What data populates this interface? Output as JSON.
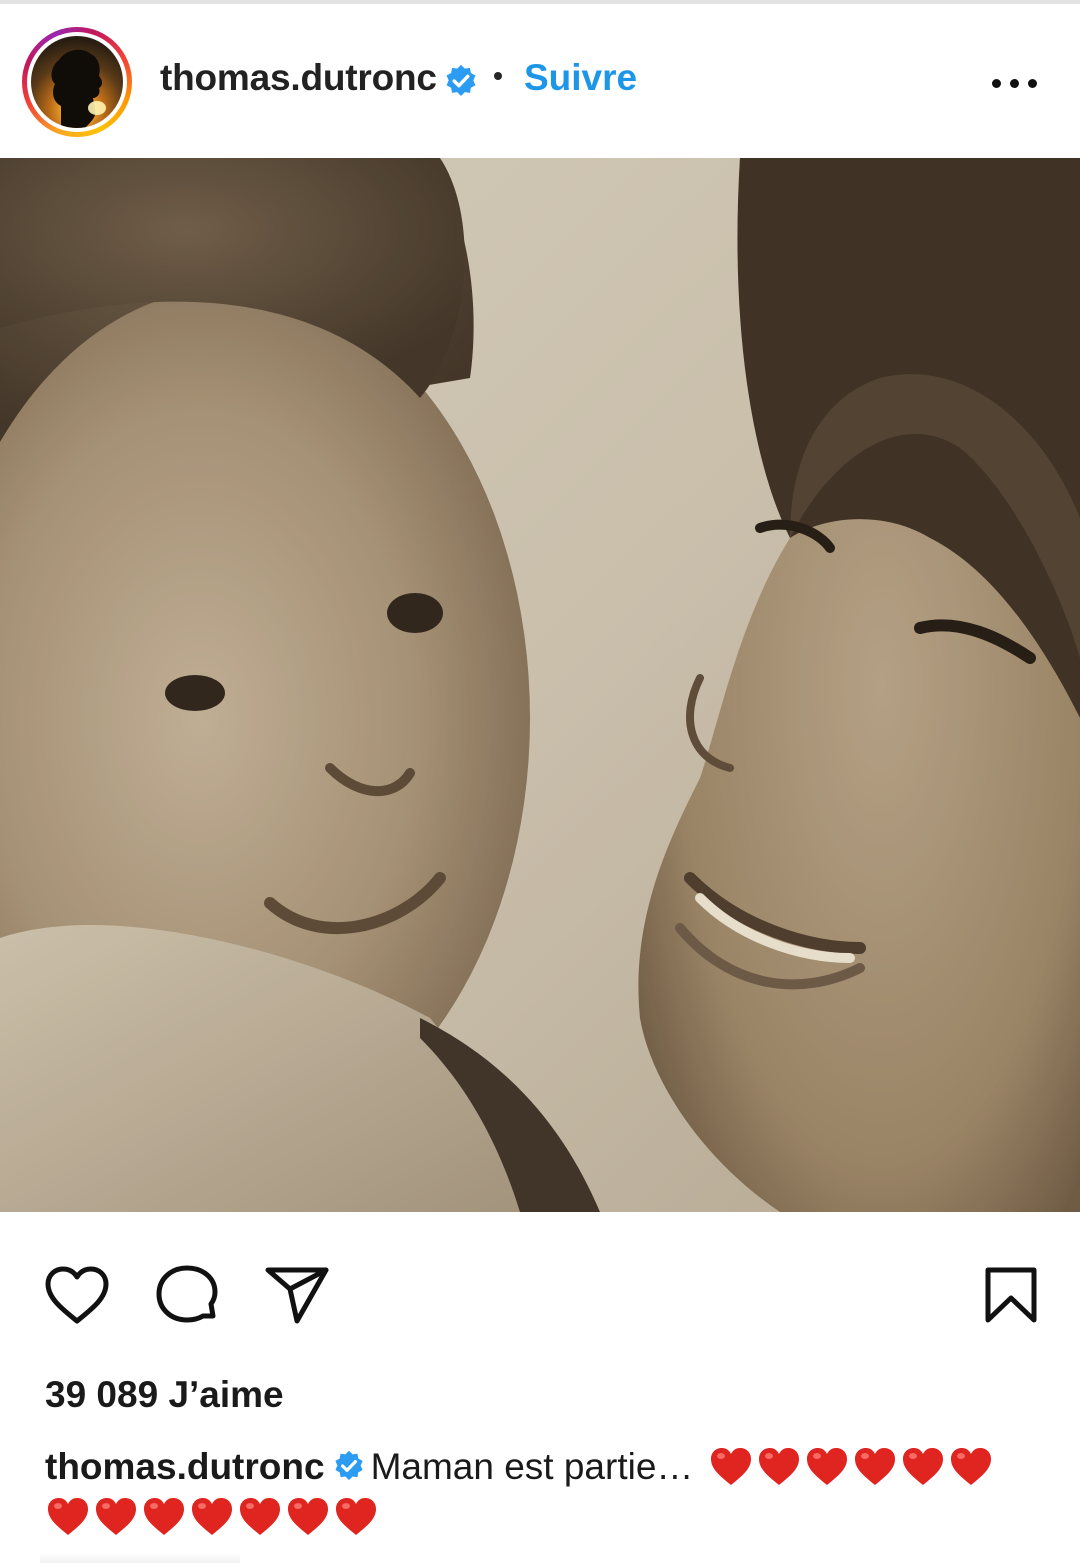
{
  "post": {
    "username": "thomas.dutronc",
    "follow_label": "Suivre",
    "likes_text": "39 089 J’aime",
    "caption": {
      "username": "thomas.dutronc",
      "text": "Maman est partie… ",
      "hearts": "❤️❤️❤️❤️❤️❤️❤️❤️❤️❤️❤️❤️❤️❤️",
      "heart_count_line1": 6,
      "heart_count_line2": 7
    }
  },
  "icons": {
    "avatar": "profile-avatar-silhouette",
    "verified": "verified-badge-icon",
    "more": "more-options-icon",
    "like": "heart-outline-icon",
    "comment": "comment-bubble-icon",
    "share": "paper-plane-icon",
    "save": "bookmark-icon"
  },
  "colors": {
    "follow_accent": "#1e96e8",
    "verified_blue": "#2b9cf2",
    "heart_red": "#e0241f",
    "photo_tone": "sepia"
  }
}
